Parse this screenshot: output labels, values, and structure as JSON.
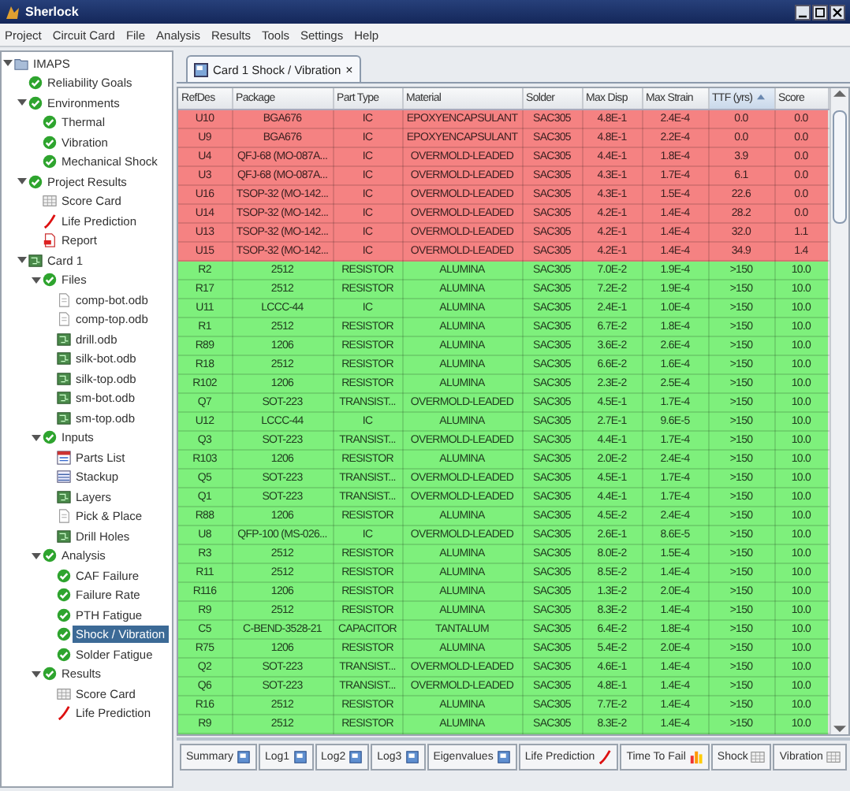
{
  "window": {
    "title": "Sherlock"
  },
  "menu": [
    "Project",
    "Circuit Card",
    "File",
    "Analysis",
    "Results",
    "Tools",
    "Settings",
    "Help"
  ],
  "tree": [
    {
      "label": "IMAPS",
      "kind": "folder",
      "expanded": true,
      "selected": false,
      "children": [
        {
          "label": "Reliability Goals",
          "kind": "check",
          "selected": false
        },
        {
          "label": "Environments",
          "kind": "check",
          "expanded": true,
          "selected": false,
          "children": [
            {
              "label": "Thermal",
              "kind": "check",
              "selected": false
            },
            {
              "label": "Vibration",
              "kind": "check",
              "selected": false
            },
            {
              "label": "Mechanical Shock",
              "kind": "check",
              "selected": false
            }
          ]
        },
        {
          "label": "Project Results",
          "kind": "check",
          "expanded": true,
          "selected": false,
          "children": [
            {
              "label": "Score Card",
              "kind": "table",
              "selected": false
            },
            {
              "label": "Life Prediction",
              "kind": "curve",
              "selected": false
            },
            {
              "label": "Report",
              "kind": "report",
              "selected": false
            }
          ]
        },
        {
          "label": "Card 1",
          "kind": "board",
          "expanded": true,
          "selected": false,
          "children": [
            {
              "label": "Files",
              "kind": "check",
              "expanded": true,
              "selected": false,
              "children": [
                {
                  "label": "comp-bot.odb",
                  "kind": "doc",
                  "selected": false
                },
                {
                  "label": "comp-top.odb",
                  "kind": "doc",
                  "selected": false
                },
                {
                  "label": "drill.odb",
                  "kind": "board",
                  "selected": false
                },
                {
                  "label": "silk-bot.odb",
                  "kind": "board",
                  "selected": false
                },
                {
                  "label": "silk-top.odb",
                  "kind": "board",
                  "selected": false
                },
                {
                  "label": "sm-bot.odb",
                  "kind": "board",
                  "selected": false
                },
                {
                  "label": "sm-top.odb",
                  "kind": "board",
                  "selected": false
                }
              ]
            },
            {
              "label": "Inputs",
              "kind": "check",
              "expanded": true,
              "selected": false,
              "children": [
                {
                  "label": "Parts List",
                  "kind": "parts",
                  "selected": false
                },
                {
                  "label": "Stackup",
                  "kind": "stack",
                  "selected": false
                },
                {
                  "label": "Layers",
                  "kind": "board",
                  "selected": false
                },
                {
                  "label": "Pick & Place",
                  "kind": "doc",
                  "selected": false
                },
                {
                  "label": "Drill Holes",
                  "kind": "board",
                  "selected": false
                }
              ]
            },
            {
              "label": "Analysis",
              "kind": "check",
              "expanded": true,
              "selected": false,
              "children": [
                {
                  "label": "CAF Failure",
                  "kind": "check",
                  "selected": false
                },
                {
                  "label": "Failure Rate",
                  "kind": "check",
                  "selected": false
                },
                {
                  "label": "PTH Fatigue",
                  "kind": "check",
                  "selected": false
                },
                {
                  "label": "Shock / Vibration",
                  "kind": "check",
                  "selected": true
                },
                {
                  "label": "Solder Fatigue",
                  "kind": "check",
                  "selected": false
                }
              ]
            },
            {
              "label": "Results",
              "kind": "check",
              "expanded": true,
              "selected": false,
              "children": [
                {
                  "label": "Score Card",
                  "kind": "table",
                  "selected": false
                },
                {
                  "label": "Life Prediction",
                  "kind": "curve",
                  "selected": false
                }
              ]
            }
          ]
        }
      ]
    }
  ],
  "doc_tab": {
    "label": "Card 1 Shock / Vibration",
    "close": "×"
  },
  "table": {
    "columns": [
      {
        "label": "RefDes",
        "sorted": false
      },
      {
        "label": "Package",
        "sorted": false
      },
      {
        "label": "Part Type",
        "sorted": false
      },
      {
        "label": "Material",
        "sorted": false
      },
      {
        "label": "Solder",
        "sorted": false
      },
      {
        "label": "Max Disp",
        "sorted": false
      },
      {
        "label": "Max Strain",
        "sorted": false
      },
      {
        "label": "TTF (yrs)",
        "sorted": true
      },
      {
        "label": "Score",
        "sorted": false
      }
    ],
    "rows": [
      {
        "color": "#f58282",
        "cells": [
          "U10",
          "BGA676",
          "IC",
          "EPOXYENCAPSULANT",
          "SAC305",
          "4.8E-1",
          "2.4E-4",
          "0.0",
          "0.0"
        ]
      },
      {
        "color": "#f58282",
        "cells": [
          "U9",
          "BGA676",
          "IC",
          "EPOXYENCAPSULANT",
          "SAC305",
          "4.8E-1",
          "2.2E-4",
          "0.0",
          "0.0"
        ]
      },
      {
        "color": "#f58282",
        "cells": [
          "U4",
          "QFJ-68 (MO-087A...",
          "IC",
          "OVERMOLD-LEADED",
          "SAC305",
          "4.4E-1",
          "1.8E-4",
          "3.9",
          "0.0"
        ]
      },
      {
        "color": "#f58282",
        "cells": [
          "U3",
          "QFJ-68 (MO-087A...",
          "IC",
          "OVERMOLD-LEADED",
          "SAC305",
          "4.3E-1",
          "1.7E-4",
          "6.1",
          "0.0"
        ]
      },
      {
        "color": "#f58282",
        "cells": [
          "U16",
          "TSOP-32 (MO-142...",
          "IC",
          "OVERMOLD-LEADED",
          "SAC305",
          "4.3E-1",
          "1.5E-4",
          "22.6",
          "0.0"
        ]
      },
      {
        "color": "#f58282",
        "cells": [
          "U14",
          "TSOP-32 (MO-142...",
          "IC",
          "OVERMOLD-LEADED",
          "SAC305",
          "4.2E-1",
          "1.4E-4",
          "28.2",
          "0.0"
        ]
      },
      {
        "color": "#f58282",
        "cells": [
          "U13",
          "TSOP-32 (MO-142...",
          "IC",
          "OVERMOLD-LEADED",
          "SAC305",
          "4.2E-1",
          "1.4E-4",
          "32.0",
          "1.1"
        ]
      },
      {
        "color": "#f58282",
        "cells": [
          "U15",
          "TSOP-32 (MO-142...",
          "IC",
          "OVERMOLD-LEADED",
          "SAC305",
          "4.2E-1",
          "1.4E-4",
          "34.9",
          "1.4"
        ]
      },
      {
        "color": "#7ef07c",
        "cells": [
          "R2",
          "2512",
          "RESISTOR",
          "ALUMINA",
          "SAC305",
          "7.0E-2",
          "1.9E-4",
          ">150",
          "10.0"
        ]
      },
      {
        "color": "#7ef07c",
        "cells": [
          "R17",
          "2512",
          "RESISTOR",
          "ALUMINA",
          "SAC305",
          "7.2E-2",
          "1.9E-4",
          ">150",
          "10.0"
        ]
      },
      {
        "color": "#7ef07c",
        "cells": [
          "U11",
          "LCCC-44",
          "IC",
          "ALUMINA",
          "SAC305",
          "2.4E-1",
          "1.0E-4",
          ">150",
          "10.0"
        ]
      },
      {
        "color": "#7ef07c",
        "cells": [
          "R1",
          "2512",
          "RESISTOR",
          "ALUMINA",
          "SAC305",
          "6.7E-2",
          "1.8E-4",
          ">150",
          "10.0"
        ]
      },
      {
        "color": "#7ef07c",
        "cells": [
          "R89",
          "1206",
          "RESISTOR",
          "ALUMINA",
          "SAC305",
          "3.6E-2",
          "2.6E-4",
          ">150",
          "10.0"
        ]
      },
      {
        "color": "#7ef07c",
        "cells": [
          "R18",
          "2512",
          "RESISTOR",
          "ALUMINA",
          "SAC305",
          "6.6E-2",
          "1.6E-4",
          ">150",
          "10.0"
        ]
      },
      {
        "color": "#7ef07c",
        "cells": [
          "R102",
          "1206",
          "RESISTOR",
          "ALUMINA",
          "SAC305",
          "2.3E-2",
          "2.5E-4",
          ">150",
          "10.0"
        ]
      },
      {
        "color": "#7ef07c",
        "cells": [
          "Q7",
          "SOT-223",
          "TRANSIST...",
          "OVERMOLD-LEADED",
          "SAC305",
          "4.5E-1",
          "1.7E-4",
          ">150",
          "10.0"
        ]
      },
      {
        "color": "#7ef07c",
        "cells": [
          "U12",
          "LCCC-44",
          "IC",
          "ALUMINA",
          "SAC305",
          "2.7E-1",
          "9.6E-5",
          ">150",
          "10.0"
        ]
      },
      {
        "color": "#7ef07c",
        "cells": [
          "Q3",
          "SOT-223",
          "TRANSIST...",
          "OVERMOLD-LEADED",
          "SAC305",
          "4.4E-1",
          "1.7E-4",
          ">150",
          "10.0"
        ]
      },
      {
        "color": "#7ef07c",
        "cells": [
          "R103",
          "1206",
          "RESISTOR",
          "ALUMINA",
          "SAC305",
          "2.0E-2",
          "2.4E-4",
          ">150",
          "10.0"
        ]
      },
      {
        "color": "#7ef07c",
        "cells": [
          "Q5",
          "SOT-223",
          "TRANSIST...",
          "OVERMOLD-LEADED",
          "SAC305",
          "4.5E-1",
          "1.7E-4",
          ">150",
          "10.0"
        ]
      },
      {
        "color": "#7ef07c",
        "cells": [
          "Q1",
          "SOT-223",
          "TRANSIST...",
          "OVERMOLD-LEADED",
          "SAC305",
          "4.4E-1",
          "1.7E-4",
          ">150",
          "10.0"
        ]
      },
      {
        "color": "#7ef07c",
        "cells": [
          "R88",
          "1206",
          "RESISTOR",
          "ALUMINA",
          "SAC305",
          "4.5E-2",
          "2.4E-4",
          ">150",
          "10.0"
        ]
      },
      {
        "color": "#7ef07c",
        "cells": [
          "U8",
          "QFP-100 (MS-026...",
          "IC",
          "OVERMOLD-LEADED",
          "SAC305",
          "2.6E-1",
          "8.6E-5",
          ">150",
          "10.0"
        ]
      },
      {
        "color": "#7ef07c",
        "cells": [
          "R3",
          "2512",
          "RESISTOR",
          "ALUMINA",
          "SAC305",
          "8.0E-2",
          "1.5E-4",
          ">150",
          "10.0"
        ]
      },
      {
        "color": "#7ef07c",
        "cells": [
          "R11",
          "2512",
          "RESISTOR",
          "ALUMINA",
          "SAC305",
          "8.5E-2",
          "1.4E-4",
          ">150",
          "10.0"
        ]
      },
      {
        "color": "#7ef07c",
        "cells": [
          "R116",
          "1206",
          "RESISTOR",
          "ALUMINA",
          "SAC305",
          "1.3E-2",
          "2.0E-4",
          ">150",
          "10.0"
        ]
      },
      {
        "color": "#7ef07c",
        "cells": [
          "R9",
          "2512",
          "RESISTOR",
          "ALUMINA",
          "SAC305",
          "8.3E-2",
          "1.4E-4",
          ">150",
          "10.0"
        ]
      },
      {
        "color": "#7ef07c",
        "cells": [
          "C5",
          "C-BEND-3528-21",
          "CAPACITOR",
          "TANTALUM",
          "SAC305",
          "6.4E-2",
          "1.8E-4",
          ">150",
          "10.0"
        ]
      },
      {
        "color": "#7ef07c",
        "cells": [
          "R75",
          "1206",
          "RESISTOR",
          "ALUMINA",
          "SAC305",
          "5.4E-2",
          "2.0E-4",
          ">150",
          "10.0"
        ]
      },
      {
        "color": "#7ef07c",
        "cells": [
          "Q2",
          "SOT-223",
          "TRANSIST...",
          "OVERMOLD-LEADED",
          "SAC305",
          "4.6E-1",
          "1.4E-4",
          ">150",
          "10.0"
        ]
      },
      {
        "color": "#7ef07c",
        "cells": [
          "Q6",
          "SOT-223",
          "TRANSIST...",
          "OVERMOLD-LEADED",
          "SAC305",
          "4.8E-1",
          "1.4E-4",
          ">150",
          "10.0"
        ]
      },
      {
        "color": "#7ef07c",
        "cells": [
          "R16",
          "2512",
          "RESISTOR",
          "ALUMINA",
          "SAC305",
          "7.7E-2",
          "1.4E-4",
          ">150",
          "10.0"
        ]
      },
      {
        "color": "#7ef07c",
        "cells": [
          "R9",
          "2512",
          "RESISTOR",
          "ALUMINA",
          "SAC305",
          "8.3E-2",
          "1.4E-4",
          ">150",
          "10.0"
        ]
      }
    ]
  },
  "bottom_tabs": [
    {
      "label": "Summary",
      "kind": "page"
    },
    {
      "label": "Log1",
      "kind": "page"
    },
    {
      "label": "Log2",
      "kind": "page"
    },
    {
      "label": "Log3",
      "kind": "page"
    },
    {
      "label": "Eigenvalues",
      "kind": "page"
    },
    {
      "label": "Life Prediction",
      "kind": "curve"
    },
    {
      "label": "Time To Fail",
      "kind": "bars"
    },
    {
      "label": "Shock",
      "kind": "grid"
    },
    {
      "label": "Vibration",
      "kind": "grid"
    }
  ]
}
